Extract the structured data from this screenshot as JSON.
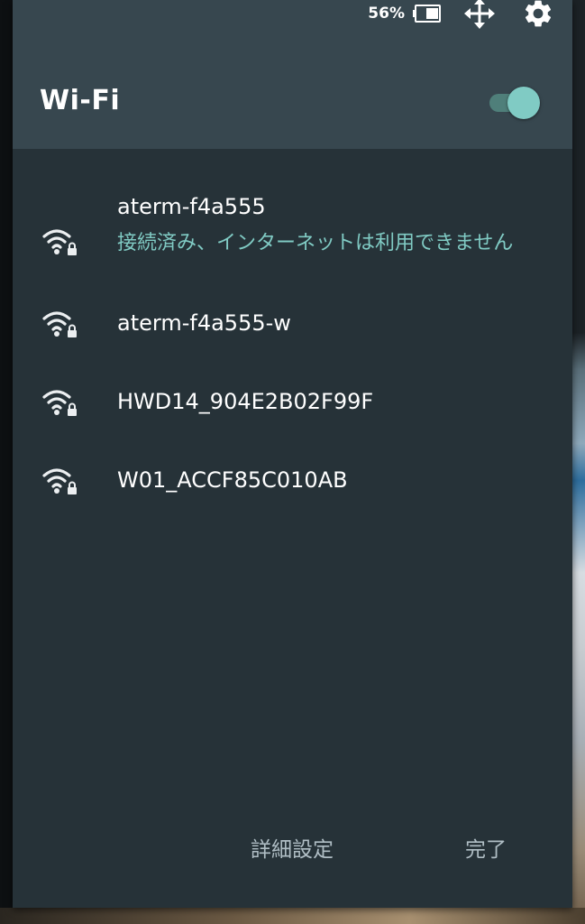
{
  "status_bar": {
    "battery_percent": "56%",
    "icons": [
      "battery-icon",
      "move-icon",
      "gear-icon"
    ]
  },
  "header": {
    "title": "Wi-Fi",
    "toggle_on": true
  },
  "networks": [
    {
      "ssid": "aterm-f4a555",
      "status": "接続済み、インターネットは利用できません",
      "icon": "wifi-locked-icon"
    },
    {
      "ssid": "aterm-f4a555-w",
      "icon": "wifi-locked-icon"
    },
    {
      "ssid": "HWD14_904E2B02F99F",
      "icon": "wifi-locked-icon"
    },
    {
      "ssid": "W01_ACCF85C010AB",
      "icon": "wifi-locked-icon"
    }
  ],
  "footer": {
    "advanced_label": "詳細設定",
    "done_label": "完了"
  },
  "colors": {
    "panel": "#263238",
    "header": "#37474f",
    "accent": "#80cbc4",
    "footer_text": "#b0bec5"
  }
}
